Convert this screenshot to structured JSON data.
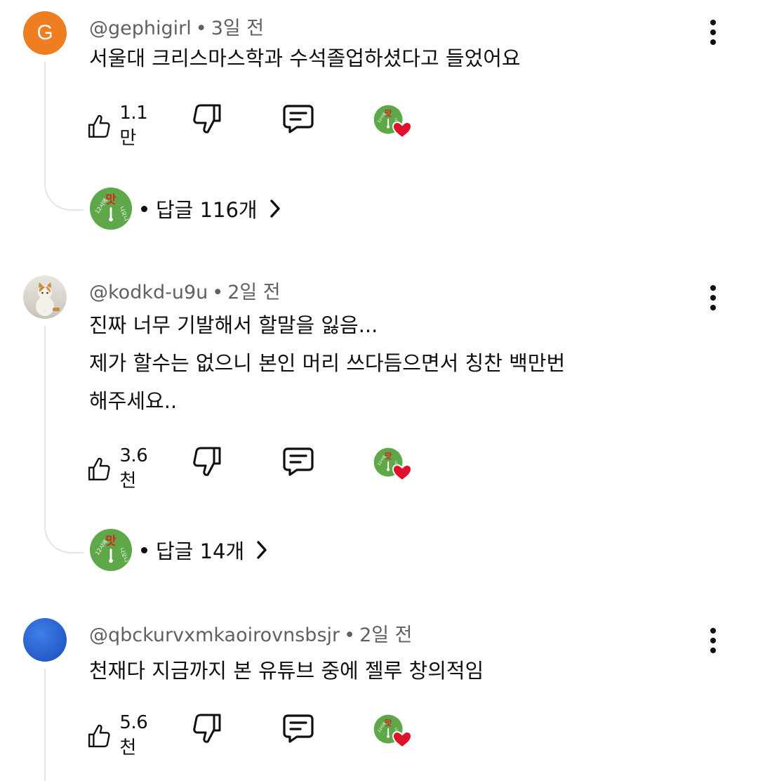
{
  "comments": [
    {
      "avatar_type": "letter",
      "avatar_letter": "G",
      "avatar_color": "#ef7d22",
      "handle": "@gephigirl",
      "time": "3일 전",
      "text": "서울대 크리스마스학과 수석졸업하셨다고 들었어요",
      "likes": "1.1만",
      "replies_label": "답글 116개"
    },
    {
      "avatar_type": "photo",
      "handle": "@kodkd-u9u",
      "time": "2일 전",
      "text": "진짜 너무 기발해서 할말을 잃음...\n제가 할수는 없으니 본인 머리 쓰다듬으면서 칭찬 백만번\n해주세요..",
      "likes": "3.6천",
      "replies_label": "답글 14개"
    },
    {
      "avatar_type": "blue",
      "avatar_color": "#2a63d1",
      "handle": "@qbckurvxmkaoirovnsbsjr",
      "time": "2일 전",
      "text": "천재다 지금까지 본 유튜브 중에 젤루 창의적임",
      "likes": "5.6천"
    }
  ],
  "icons": {
    "like": "thumbs-up-icon",
    "dislike": "thumbs-down-icon",
    "reply": "comment-icon",
    "menu": "more-vert-icon",
    "creator_heart": "creator-heart-icon",
    "expand": "chevron-right-icon"
  },
  "colors": {
    "creator_avatar": "#5fa84a",
    "heart": "#e0112b",
    "thread_line": "#e4e4e4",
    "meta_text": "#606060"
  }
}
